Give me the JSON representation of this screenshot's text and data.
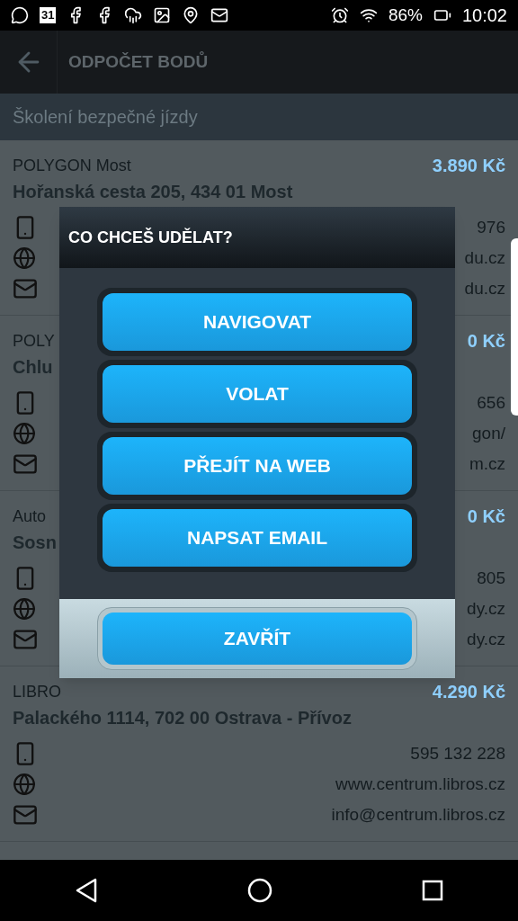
{
  "status_bar": {
    "battery": "86%",
    "time": "10:02",
    "calendar_day": "31"
  },
  "header": {
    "title": "ODPOČET BODŮ"
  },
  "section": {
    "title": "Školení bezpečné jízdy"
  },
  "items": [
    {
      "name": "POLYGON Most",
      "address": "Hořanská cesta 205, 434 01 Most",
      "price": "3.890 Kč",
      "phone": "976",
      "web": "du.cz",
      "email": "du.cz"
    },
    {
      "name": "POLY",
      "address": "Chlu",
      "price": "0 Kč",
      "phone": "656",
      "web": "gon/",
      "email": "m.cz"
    },
    {
      "name": "Auto",
      "address": "Sosn",
      "price": "0 Kč",
      "phone": "805",
      "web": "dy.cz",
      "email": "dy.cz"
    },
    {
      "name": "LIBRO",
      "address": "Palackého 1114, 702 00 Ostrava - Přívoz",
      "price": "4.290 Kč",
      "phone": "595 132 228",
      "web": "www.centrum.libros.cz",
      "email": "info@centrum.libros.cz"
    }
  ],
  "dialog": {
    "title": "CO CHCEŠ UDĚLAT?",
    "actions": [
      "NAVIGOVAT",
      "VOLAT",
      "PŘEJÍT NA WEB",
      "NAPSAT EMAIL"
    ],
    "close": "ZAVŘÍT"
  }
}
